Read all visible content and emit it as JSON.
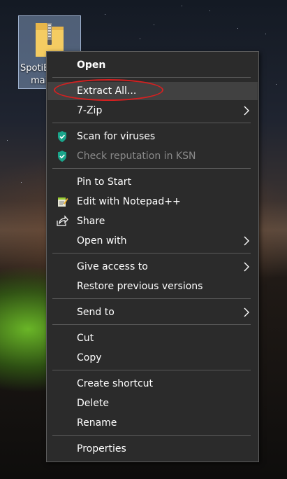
{
  "desktop_icon": {
    "label_line1": "SpotiBl",
    "label_line2": "mai"
  },
  "context_menu": {
    "items": {
      "open": "Open",
      "extract_all": "Extract All...",
      "seven_zip": "7-Zip",
      "scan_viruses": "Scan for viruses",
      "check_reputation": "Check reputation in KSN",
      "pin_to_start": "Pin to Start",
      "edit_notepad": "Edit with Notepad++",
      "share": "Share",
      "open_with": "Open with",
      "give_access": "Give access to",
      "restore_versions": "Restore previous versions",
      "send_to": "Send to",
      "cut": "Cut",
      "copy": "Copy",
      "create_shortcut": "Create shortcut",
      "delete": "Delete",
      "rename": "Rename",
      "properties": "Properties"
    },
    "icons": {
      "scan_viruses": "kaspersky-shield-icon",
      "check_reputation": "kaspersky-shield-icon",
      "edit_notepad": "notepad-plus-plus-icon",
      "share": "share-icon",
      "submenu": "chevron-right-icon"
    },
    "colors": {
      "background": "#2b2b2b",
      "highlight": "#414141",
      "annotation": "#d62020",
      "shield": "#1aa58b"
    }
  }
}
